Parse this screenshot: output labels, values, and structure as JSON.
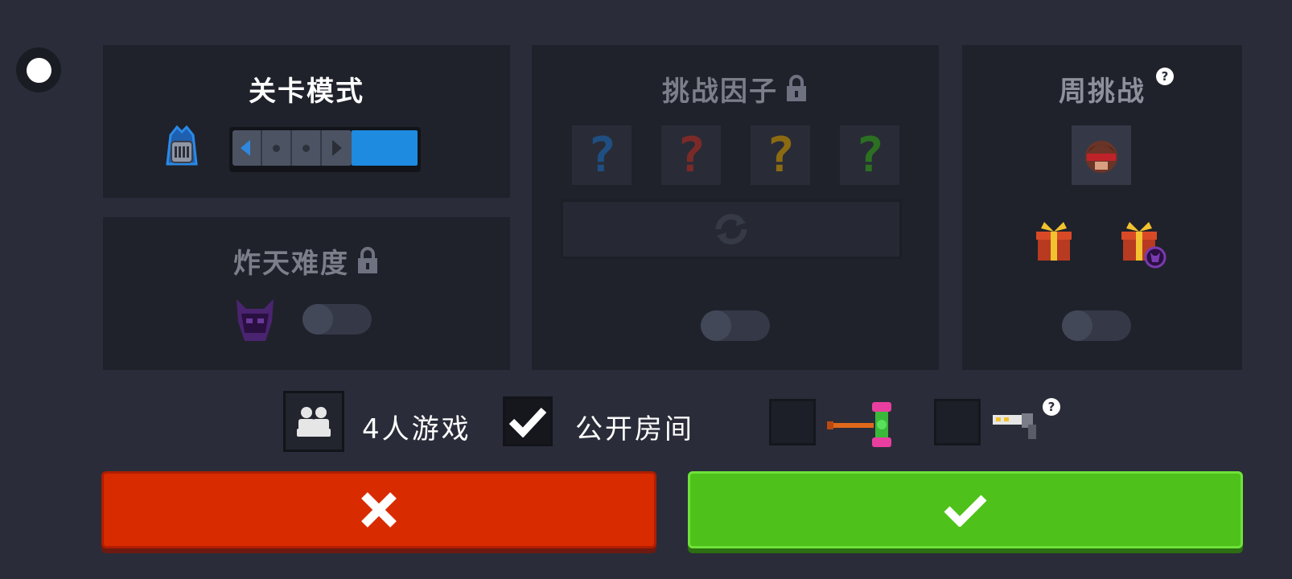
{
  "panels": {
    "stage_mode": {
      "title": "关卡模式"
    },
    "difficulty": {
      "title": "炸天难度",
      "locked": true,
      "toggle_on": false
    },
    "challenge_factor": {
      "title": "挑战因子",
      "locked": true,
      "cards": [
        {
          "symbol": "?",
          "color": "#1f4f82"
        },
        {
          "symbol": "?",
          "color": "#7c2a28"
        },
        {
          "symbol": "?",
          "color": "#8b6a12"
        },
        {
          "symbol": "?",
          "color": "#2c7022"
        }
      ],
      "toggle_on": false
    },
    "weekly_challenge": {
      "title": "周挑战",
      "help_symbol": "?",
      "toggle_on": false
    }
  },
  "options": {
    "multiplayer_label": "4人游戏",
    "public_room_label": "公开房间",
    "public_room_checked": true,
    "hammer_checked": false,
    "gun_checked": false,
    "gun_help_symbol": "?"
  },
  "colors": {
    "background": "#2a2d39",
    "panel": "#1f222b",
    "mode_fill": "#1e8ae0",
    "cancel": "#d92b00",
    "confirm": "#4ec21a"
  }
}
